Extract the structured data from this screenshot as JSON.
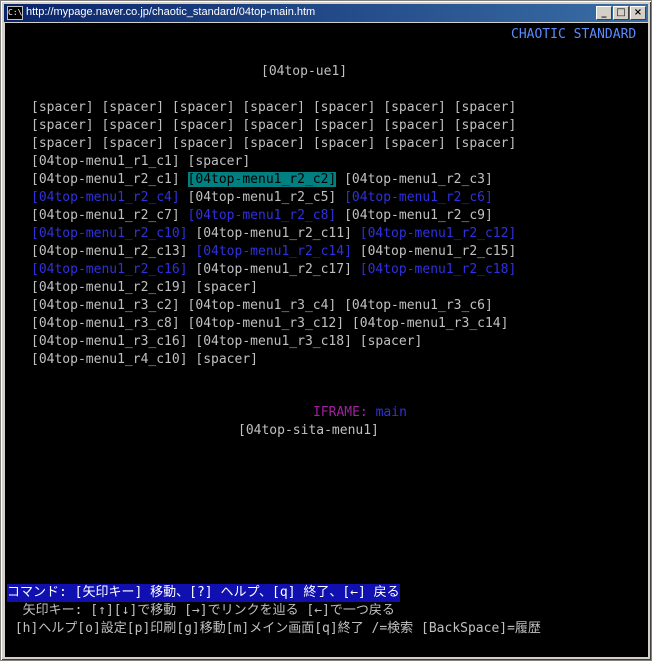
{
  "window": {
    "title": "http://mypage.naver.co.jp/chaotic_standard/04top-main.htm",
    "icon_label": "C:\\",
    "minimize": "_",
    "maximize": "□",
    "close": "×"
  },
  "header": {
    "brand": "CHAOTIC STANDARD",
    "top_image": "[04top-ue1]"
  },
  "menu_rows": [
    [
      {
        "text": "[spacer]",
        "c": "link"
      },
      {
        "text": "[spacer]",
        "c": "link"
      },
      {
        "text": "[spacer]",
        "c": "link"
      },
      {
        "text": "[spacer]",
        "c": "link"
      },
      {
        "text": "[spacer]",
        "c": "link"
      },
      {
        "text": "[spacer]",
        "c": "link"
      },
      {
        "text": "[spacer]",
        "c": "link"
      }
    ],
    [
      {
        "text": "[spacer]",
        "c": "link"
      },
      {
        "text": "[spacer]",
        "c": "link"
      },
      {
        "text": "[spacer]",
        "c": "link"
      },
      {
        "text": "[spacer]",
        "c": "link"
      },
      {
        "text": "[spacer]",
        "c": "link"
      },
      {
        "text": "[spacer]",
        "c": "link"
      },
      {
        "text": "[spacer]",
        "c": "link"
      }
    ],
    [
      {
        "text": "[spacer]",
        "c": "link"
      },
      {
        "text": "[spacer]",
        "c": "link"
      },
      {
        "text": "[spacer]",
        "c": "link"
      },
      {
        "text": "[spacer]",
        "c": "link"
      },
      {
        "text": "[spacer]",
        "c": "link"
      },
      {
        "text": "[spacer]",
        "c": "link"
      },
      {
        "text": "[spacer]",
        "c": "link"
      }
    ],
    [
      {
        "text": "[04top-menu1_r1_c1]",
        "c": "link"
      },
      {
        "text": "[spacer]",
        "c": "link"
      }
    ],
    [
      {
        "text": "[04top-menu1_r2_c1]",
        "c": "link"
      },
      {
        "text": "[04top-menu1_r2_c2]",
        "c": "sel"
      },
      {
        "text": "[04top-menu1_r2_c3]",
        "c": "link"
      }
    ],
    [
      {
        "text": "[04top-menu1_r2_c4]",
        "c": "blue"
      },
      {
        "text": "[04top-menu1_r2_c5]",
        "c": "link"
      },
      {
        "text": "[04top-menu1_r2_c6]",
        "c": "blue"
      }
    ],
    [
      {
        "text": "[04top-menu1_r2_c7]",
        "c": "link"
      },
      {
        "text": "[04top-menu1_r2_c8]",
        "c": "blue"
      },
      {
        "text": "[04top-menu1_r2_c9]",
        "c": "link"
      }
    ],
    [
      {
        "text": "[04top-menu1_r2_c10]",
        "c": "blue"
      },
      {
        "text": "[04top-menu1_r2_c11]",
        "c": "link"
      },
      {
        "text": "[04top-menu1_r2_c12]",
        "c": "blue"
      }
    ],
    [
      {
        "text": "[04top-menu1_r2_c13]",
        "c": "link"
      },
      {
        "text": "[04top-menu1_r2_c14]",
        "c": "blue"
      },
      {
        "text": "[04top-menu1_r2_c15]",
        "c": "link"
      }
    ],
    [
      {
        "text": "[04top-menu1_r2_c16]",
        "c": "blue"
      },
      {
        "text": "[04top-menu1_r2_c17]",
        "c": "link"
      },
      {
        "text": "[04top-menu1_r2_c18]",
        "c": "blue"
      }
    ],
    [
      {
        "text": "[04top-menu1_r2_c19]",
        "c": "link"
      },
      {
        "text": "[spacer]",
        "c": "link"
      }
    ],
    [
      {
        "text": "[04top-menu1_r3_c2]",
        "c": "link"
      },
      {
        "text": "[04top-menu1_r3_c4]",
        "c": "link"
      },
      {
        "text": "[04top-menu1_r3_c6]",
        "c": "link"
      }
    ],
    [
      {
        "text": "[04top-menu1_r3_c8]",
        "c": "link"
      },
      {
        "text": "[04top-menu1_r3_c12]",
        "c": "link"
      },
      {
        "text": "[04top-menu1_r3_c14]",
        "c": "link"
      }
    ],
    [
      {
        "text": "[04top-menu1_r3_c16]",
        "c": "link"
      },
      {
        "text": "[04top-menu1_r3_c18]",
        "c": "link"
      },
      {
        "text": "[spacer]",
        "c": "link"
      }
    ],
    [
      {
        "text": "[04top-menu1_r4_c10]",
        "c": "link"
      },
      {
        "text": "[spacer]",
        "c": "link"
      }
    ]
  ],
  "iframe": {
    "label": "IFRAME:",
    "name": "main"
  },
  "bottom_image": "[04top-sita-menu1]",
  "status": {
    "command_line": "コマンド: [矢印キー] 移動、[?] ヘルプ、[q] 終了、[←] 戻る",
    "keys_line": "  矢印キー: [↑][↓]で移動 [→]でリンクを辿る [←]で一つ戻る",
    "help_line": " [h]ヘルプ[o]設定[p]印刷[g]移動[m]メイン画面[q]終了 /=検索 [BackSpace]=履歴"
  },
  "colors": {
    "background": "#000000",
    "text": "#c0c0c0",
    "link_alt": "#3030e0",
    "selected_bg": "#008080",
    "brand": "#5a8cff",
    "status_bg": "#1010b0"
  }
}
